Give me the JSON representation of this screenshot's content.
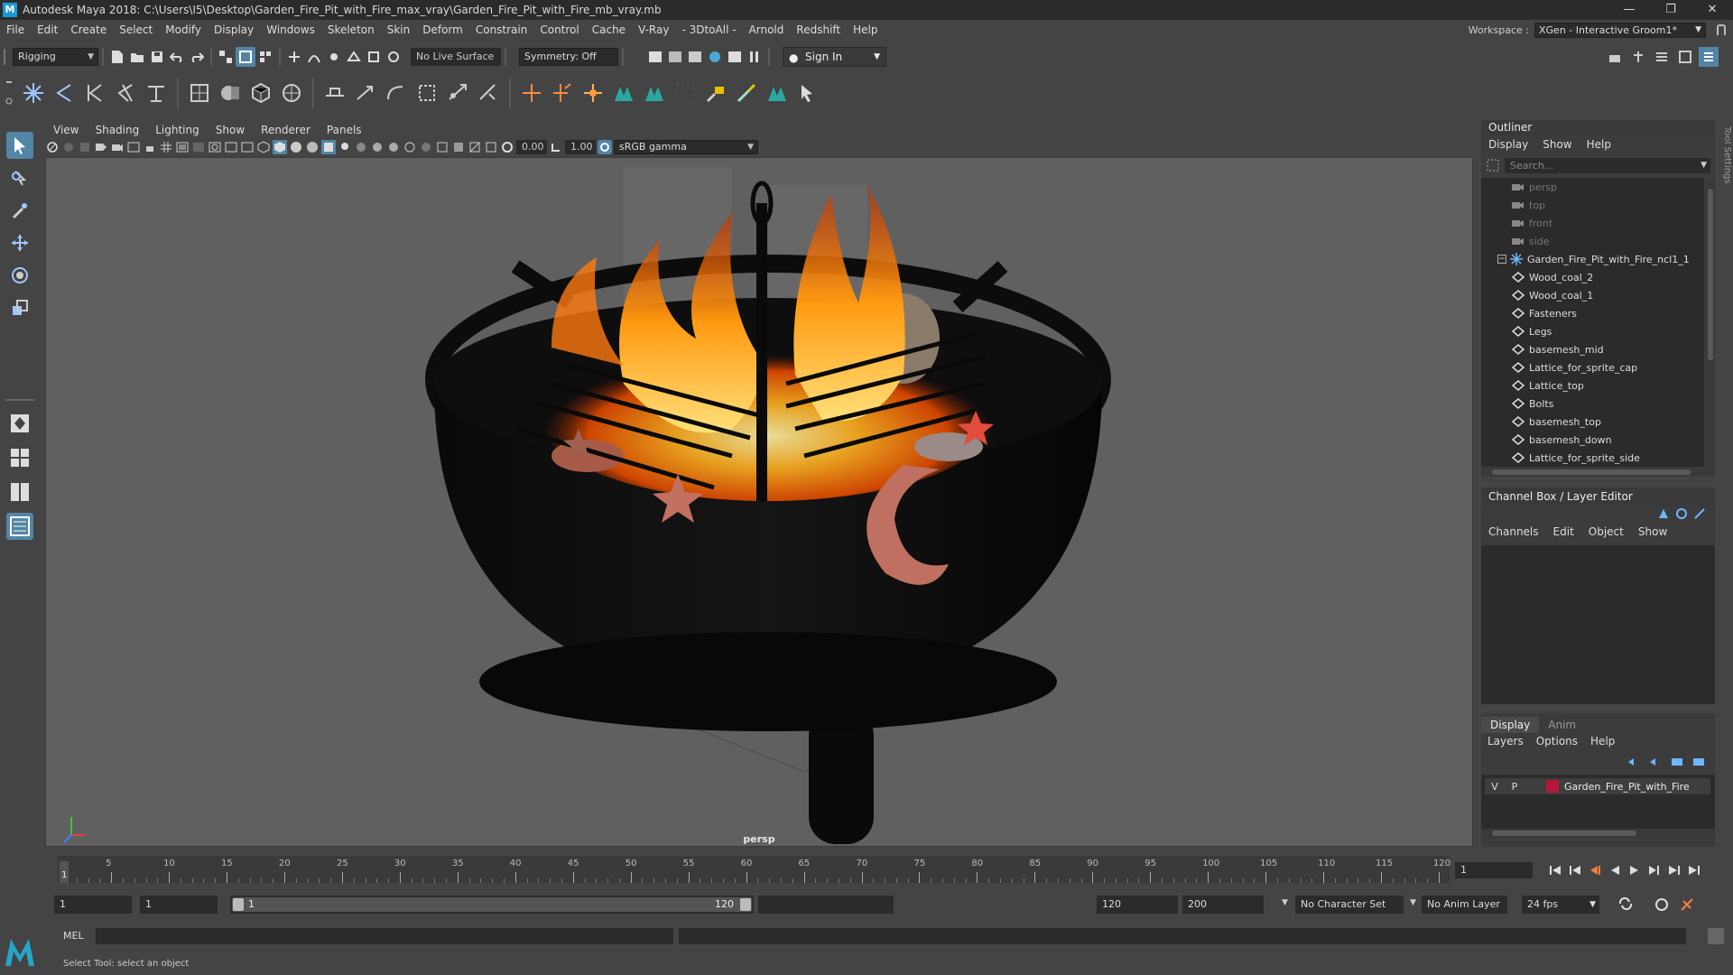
{
  "window": {
    "title": "Autodesk Maya 2018: C:\\Users\\I5\\Desktop\\Garden_Fire_Pit_with_Fire_max_vray\\Garden_Fire_Pit_with_Fire_mb_vray.mb",
    "logo": "M",
    "minimize": "—",
    "maximize": "❐",
    "close": "✕"
  },
  "menubar": [
    "File",
    "Edit",
    "Create",
    "Select",
    "Modify",
    "Display",
    "Windows",
    "Skeleton",
    "Skin",
    "Deform",
    "Constrain",
    "Control",
    "Cache",
    "V-Ray",
    "- 3DtoAll -",
    "Arnold",
    "Redshift",
    "Help"
  ],
  "workspace": {
    "label": "Workspace :",
    "value": "XGen - Interactive Groom1*"
  },
  "statusline": {
    "menuset": "Rigging",
    "live_surface": "No Live Surface",
    "symmetry": "Symmetry: Off",
    "sign_in": "Sign In"
  },
  "viewport": {
    "menus": [
      "View",
      "Shading",
      "Lighting",
      "Show",
      "Renderer",
      "Panels"
    ],
    "exposure": "0.00",
    "gamma": "1.00",
    "color_space": "sRGB gamma",
    "camera_label": "persp"
  },
  "outliner": {
    "title": "Outliner",
    "menus": [
      "Display",
      "Show",
      "Help"
    ],
    "search_placeholder": "Search...",
    "cameras": [
      "persp",
      "top",
      "front",
      "side"
    ],
    "group": "Garden_Fire_Pit_with_Fire_ncl1_1",
    "children": [
      "Wood_coal_2",
      "Wood_coal_1",
      "Fasteners",
      "Legs",
      "basemesh_mid",
      "Lattice_for_sprite_cap",
      "Lattice_top",
      "Bolts",
      "basemesh_top",
      "basemesh_down",
      "Lattice_for_sprite_side"
    ]
  },
  "channelbox": {
    "title": "Channel Box / Layer Editor",
    "menus": [
      "Channels",
      "Edit",
      "Object",
      "Show"
    ]
  },
  "layereditor": {
    "tabs": [
      "Display",
      "Anim"
    ],
    "menus": [
      "Layers",
      "Options",
      "Help"
    ],
    "layer": {
      "v": "V",
      "p": "P",
      "name": "Garden_Fire_Pit_with_Fire",
      "color": "#b5173a"
    }
  },
  "toolsettings": "Tool Settings",
  "timeline": {
    "ticks": [
      "5",
      "10",
      "15",
      "20",
      "25",
      "30",
      "35",
      "40",
      "45",
      "50",
      "55",
      "60",
      "65",
      "70",
      "75",
      "80",
      "85",
      "90",
      "95",
      "100",
      "105",
      "110",
      "115",
      "120"
    ],
    "current_frame": "1",
    "current_field": "1"
  },
  "range": {
    "start": "1",
    "start2": "1",
    "slider_start": "1",
    "slider_end": "120",
    "end": "120",
    "end2": "200",
    "character_set": "No Character Set",
    "anim_layer": "No Anim Layer",
    "fps": "24 fps"
  },
  "cmdline": {
    "label": "MEL"
  },
  "helpline": "Select Tool: select an object",
  "colors": {
    "accent": "#5285a6",
    "panel": "#444444",
    "field": "#2b2b2b"
  }
}
